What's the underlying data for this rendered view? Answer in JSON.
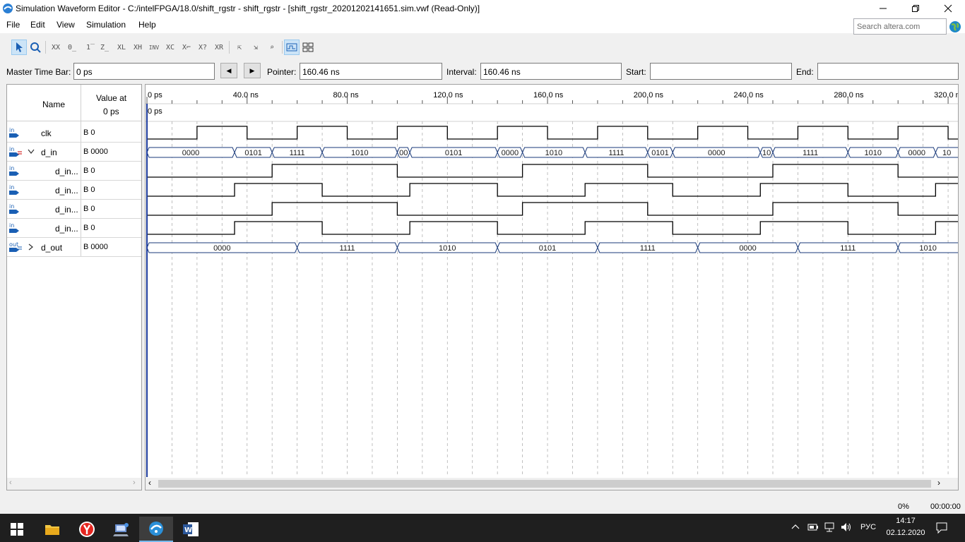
{
  "window": {
    "title": "Simulation Waveform Editor - C:/intelFPGA/18.0/shift_rgstr - shift_rgstr - [shift_rgstr_20201202141651.sim.vwf (Read-Only)]"
  },
  "menu": [
    "File",
    "Edit",
    "View",
    "Simulation",
    "Help"
  ],
  "search": {
    "placeholder": "Search altera.com"
  },
  "toolbar": {
    "buttons": [
      "pointer-tool",
      "zoom-tool",
      "uninitialized",
      "forcing-low",
      "forcing-high",
      "high-impedance",
      "weak-low",
      "weak-high",
      "invert",
      "count-value",
      "clock",
      "random",
      "dont-care",
      "snap-to-grid",
      "waveform-view",
      "grid-view"
    ]
  },
  "timebar": {
    "master_label": "Master Time Bar:",
    "master_value": "0 ps",
    "pointer_label": "Pointer:",
    "pointer_value": "160.46 ns",
    "interval_label": "Interval:",
    "interval_value": "160.46 ns",
    "start_label": "Start:",
    "start_value": "",
    "end_label": "End:",
    "end_value": ""
  },
  "columns": {
    "name": "Name",
    "value_line1": "Value at",
    "value_line2": "0 ps"
  },
  "signals": [
    {
      "name": "clk",
      "value": "B 0",
      "type": "in"
    },
    {
      "name": "d_in",
      "value": "B 0000",
      "type": "bus-in"
    },
    {
      "name": "d_in...",
      "value": "B 0",
      "type": "in"
    },
    {
      "name": "d_in...",
      "value": "B 0",
      "type": "in"
    },
    {
      "name": "d_in...",
      "value": "B 0",
      "type": "in"
    },
    {
      "name": "d_in...",
      "value": "B 0",
      "type": "in"
    },
    {
      "name": "d_out",
      "value": "B 0000",
      "type": "out"
    }
  ],
  "timeline": {
    "max_ns": 320,
    "major_labels": [
      "0 ps",
      "40.0 ns",
      "80.0 ns",
      "120.0 ns",
      "160.0 ns",
      "200.0 ns",
      "240.0 ns",
      "280.0 ns",
      "320.0 ns"
    ],
    "master_marker": "0 ps"
  },
  "waves": {
    "clk": [
      [
        0,
        0
      ],
      [
        20,
        1
      ],
      [
        40,
        0
      ],
      [
        60,
        1
      ],
      [
        80,
        0
      ],
      [
        100,
        1
      ],
      [
        120,
        0
      ],
      [
        140,
        1
      ],
      [
        160,
        0
      ],
      [
        180,
        1
      ],
      [
        200,
        0
      ],
      [
        220,
        1
      ],
      [
        240,
        0
      ],
      [
        260,
        1
      ],
      [
        280,
        0
      ],
      [
        300,
        1
      ],
      [
        320,
        0
      ]
    ],
    "d_in": [
      [
        0,
        "0000"
      ],
      [
        35,
        "0101"
      ],
      [
        50,
        "1111"
      ],
      [
        70,
        "1010"
      ],
      [
        100,
        "00"
      ],
      [
        105,
        "0101"
      ],
      [
        140,
        "0000"
      ],
      [
        150,
        "1010"
      ],
      [
        175,
        "1111"
      ],
      [
        200,
        "0101"
      ],
      [
        210,
        "0000"
      ],
      [
        245,
        "10"
      ],
      [
        250,
        "1111"
      ],
      [
        280,
        "1010"
      ],
      [
        300,
        "0000"
      ],
      [
        315,
        "10"
      ]
    ],
    "d_in_3": [
      [
        0,
        0
      ],
      [
        50,
        1
      ],
      [
        100,
        0
      ],
      [
        150,
        1
      ],
      [
        200,
        0
      ],
      [
        250,
        1
      ],
      [
        300,
        0
      ]
    ],
    "d_in_2": [
      [
        0,
        0
      ],
      [
        35,
        1
      ],
      [
        70,
        0
      ],
      [
        105,
        1
      ],
      [
        140,
        0
      ],
      [
        175,
        1
      ],
      [
        210,
        0
      ],
      [
        245,
        1
      ],
      [
        280,
        0
      ],
      [
        315,
        1
      ]
    ],
    "d_in_1": [
      [
        0,
        0
      ],
      [
        50,
        1
      ],
      [
        100,
        0
      ],
      [
        150,
        1
      ],
      [
        200,
        0
      ],
      [
        250,
        1
      ],
      [
        300,
        0
      ]
    ],
    "d_in_0": [
      [
        0,
        0
      ],
      [
        35,
        1
      ],
      [
        70,
        0
      ],
      [
        105,
        1
      ],
      [
        140,
        0
      ],
      [
        175,
        1
      ],
      [
        210,
        0
      ],
      [
        245,
        1
      ],
      [
        280,
        0
      ],
      [
        315,
        1
      ]
    ],
    "d_out": [
      [
        0,
        "0000"
      ],
      [
        60,
        "1111"
      ],
      [
        100,
        "1010"
      ],
      [
        140,
        "0101"
      ],
      [
        180,
        "1111"
      ],
      [
        220,
        "0000"
      ],
      [
        260,
        "1111"
      ],
      [
        300,
        "1010"
      ]
    ]
  },
  "status": {
    "progress": "0%",
    "elapsed": "00:00:00"
  },
  "taskbar": {
    "apps": [
      "start-icon",
      "file-explorer-icon",
      "yandex-browser-icon",
      "network-app-icon",
      "quartus-icon",
      "word-icon"
    ],
    "lang": "РУС",
    "time": "14:17",
    "date": "02.12.2020"
  },
  "colors": {
    "accent": "#0078d7",
    "wave": "#000000",
    "grid": "#b0b0b0",
    "bus_text": "#1a1a1a",
    "master_bar": "#1c3b9c"
  }
}
